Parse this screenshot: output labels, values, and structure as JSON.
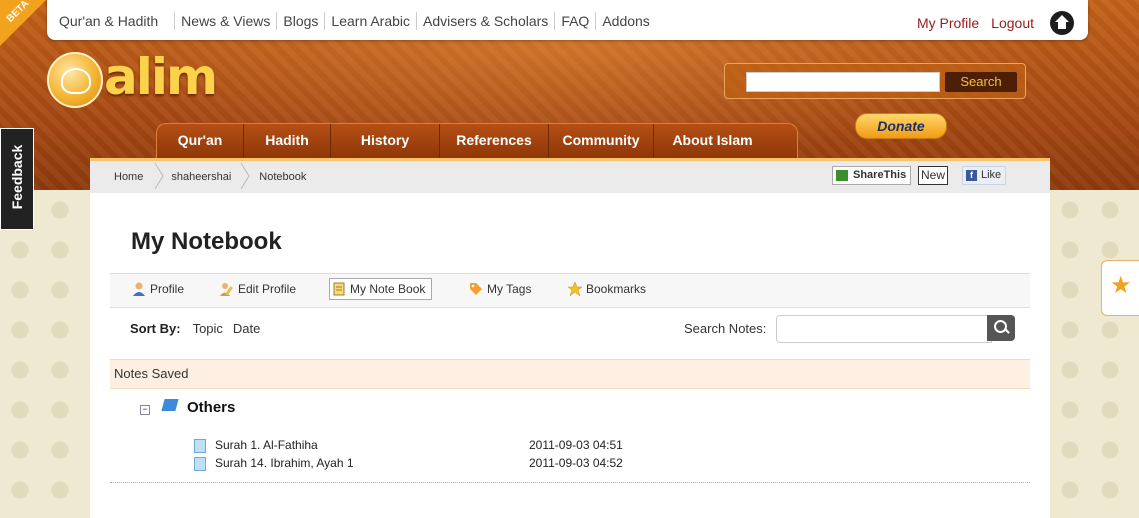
{
  "top_nav": {
    "items": [
      "Qur'an & Hadith",
      "News & Views",
      "Blogs",
      "Learn Arabic",
      "Advisers & Scholars",
      "FAQ",
      "Addons"
    ],
    "my_profile": "My Profile",
    "logout": "Logout"
  },
  "beta": "BETA",
  "logo": {
    "text": "alim"
  },
  "site_search": {
    "placeholder": "",
    "button": "Search"
  },
  "main_nav": [
    "Qur'an",
    "Hadith",
    "History",
    "References",
    "Community",
    "About Islam"
  ],
  "donate": "Donate",
  "feedback": "Feedback",
  "breadcrumb": [
    "Home",
    "shaheershai",
    "Notebook"
  ],
  "share": {
    "share_this": "ShareThis",
    "new": "New",
    "like": "Like"
  },
  "page_title": "My Notebook",
  "tabs": [
    {
      "label": "Profile",
      "icon": "user-icon"
    },
    {
      "label": "Edit Profile",
      "icon": "edit-icon"
    },
    {
      "label": "My Note Book",
      "icon": "notebook-icon",
      "active": true
    },
    {
      "label": "My Tags",
      "icon": "tag-icon"
    },
    {
      "label": "Bookmarks",
      "icon": "star-icon"
    }
  ],
  "sort": {
    "label": "Sort By:",
    "options": [
      "Topic",
      "Date"
    ]
  },
  "search_notes": {
    "label": "Search Notes:",
    "placeholder": ""
  },
  "notes_saved": "Notes Saved",
  "groups": [
    {
      "name": "Others",
      "notes": [
        {
          "title": "Surah 1. Al-Fathiha",
          "date": "2011-09-03 04:51"
        },
        {
          "title": "Surah 14. Ibrahim, Ayah 1",
          "date": "2011-09-03 04:52"
        }
      ]
    }
  ],
  "colors": {
    "header": "#a84a14",
    "accent": "#f5b431",
    "link": "#9a1b1b"
  }
}
